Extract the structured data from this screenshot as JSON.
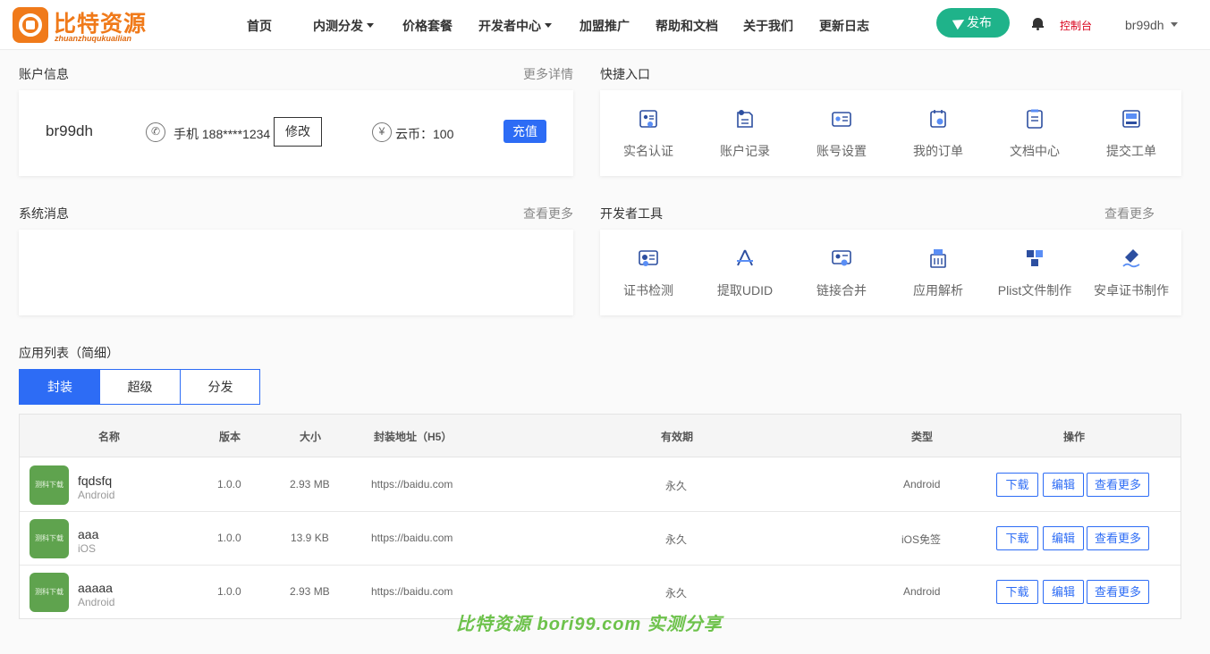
{
  "brand": {
    "name": "比特资源",
    "subtitle": "zhuanzhuqukuailian"
  },
  "nav": [
    {
      "label": "首页",
      "dropdown": false
    },
    {
      "label": "内测分发",
      "dropdown": true
    },
    {
      "label": "价格套餐",
      "dropdown": false
    },
    {
      "label": "开发者中心",
      "dropdown": true
    },
    {
      "label": "加盟推广",
      "dropdown": false
    },
    {
      "label": "帮助和文档",
      "dropdown": false
    },
    {
      "label": "关于我们",
      "dropdown": false
    },
    {
      "label": "更新日志",
      "dropdown": false
    }
  ],
  "header": {
    "publish_label": "发布",
    "console_label": "控制台",
    "username": "br99dh"
  },
  "account": {
    "title": "账户信息",
    "more": "更多详情",
    "username": "br99dh",
    "phone": "手机 188****1234",
    "edit_label": "修改",
    "coin_symbol": "¥",
    "coin": "云币：100",
    "recharge_label": "充值"
  },
  "shortcuts": {
    "title": "快捷入口",
    "items": [
      {
        "label": "实名认证",
        "icon": "id-card-icon"
      },
      {
        "label": "账户记录",
        "icon": "record-icon"
      },
      {
        "label": "账号设置",
        "icon": "settings-card-icon"
      },
      {
        "label": "我的订单",
        "icon": "order-icon"
      },
      {
        "label": "文档中心",
        "icon": "document-icon"
      },
      {
        "label": "提交工单",
        "icon": "ticket-icon"
      }
    ]
  },
  "messages": {
    "title": "系统消息",
    "more": "查看更多"
  },
  "devtools": {
    "title": "开发者工具",
    "more": "查看更多",
    "items": [
      {
        "label": "证书检测",
        "icon": "certificate-icon"
      },
      {
        "label": "提取UDID",
        "icon": "app-store-icon"
      },
      {
        "label": "链接合并",
        "icon": "link-merge-icon"
      },
      {
        "label": "应用解析",
        "icon": "app-parse-icon"
      },
      {
        "label": "Plist文件制作",
        "icon": "cubes-icon"
      },
      {
        "label": "安卓证书制作",
        "icon": "pen-sign-icon"
      }
    ]
  },
  "apps": {
    "title": "应用列表（简细）",
    "tabs": [
      "封装",
      "超级",
      "分发"
    ],
    "columns": [
      "名称",
      "版本",
      "大小",
      "封装地址（H5）",
      "有效期",
      "类型",
      "操作"
    ],
    "icon_text": "测科下载",
    "actions": [
      "下载",
      "编辑",
      "查看更多"
    ],
    "rows": [
      {
        "name": "fqdsfq",
        "platform": "Android",
        "version": "1.0.0",
        "size": "2.93 MB",
        "url": "https://baidu.com",
        "validity": "永久",
        "type": "Android"
      },
      {
        "name": "aaa",
        "platform": "iOS",
        "version": "1.0.0",
        "size": "13.9 KB",
        "url": "https://baidu.com",
        "validity": "永久",
        "type": "iOS免签"
      },
      {
        "name": "aaaaa",
        "platform": "Android",
        "version": "1.0.0",
        "size": "2.93 MB",
        "url": "https://baidu.com",
        "validity": "永久",
        "type": "Android"
      }
    ]
  },
  "watermark": "比特资源 bori99.com 实测分享",
  "colors": {
    "brand": "#f07a1a",
    "primary": "#2d6cf5",
    "publish": "#1fb38a",
    "console": "#d9001b",
    "icon": "#2d4fa0"
  }
}
